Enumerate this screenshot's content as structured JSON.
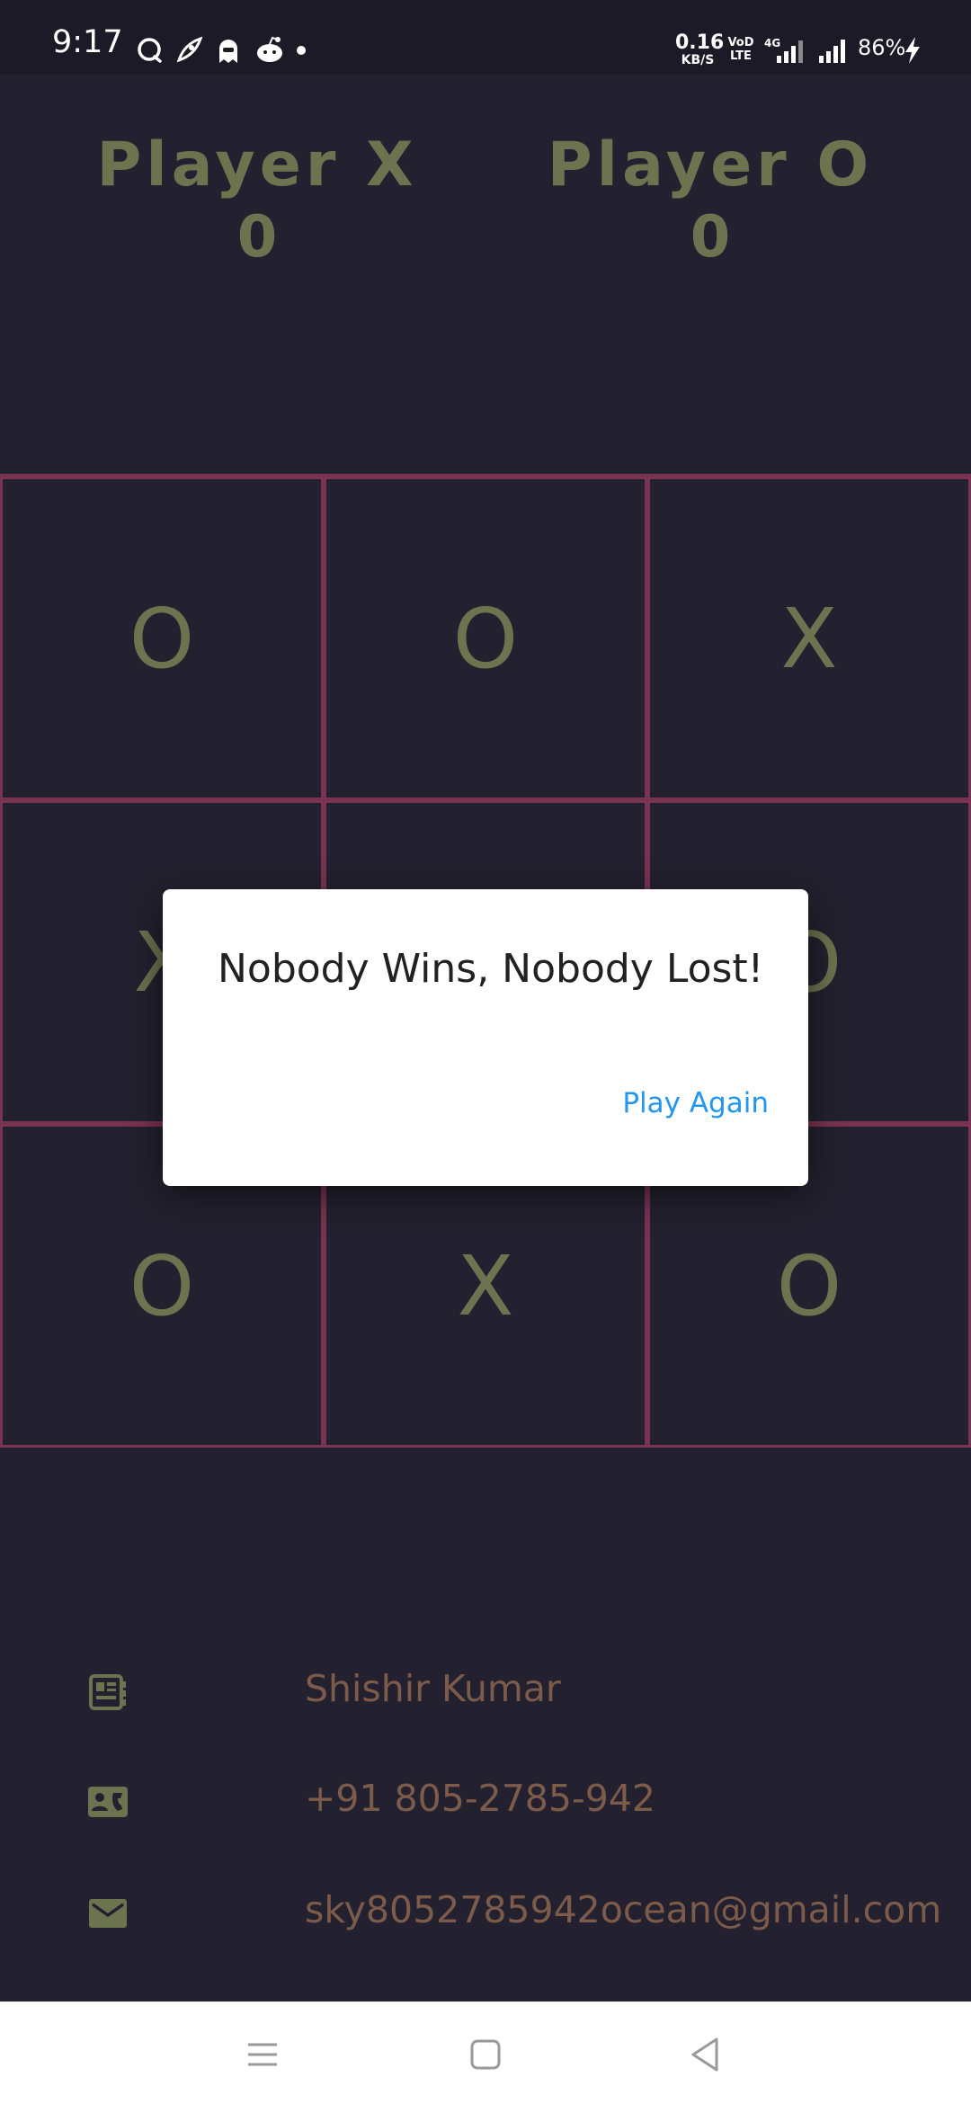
{
  "status_bar": {
    "time": "9:17",
    "net_speed_value": "0.16",
    "net_speed_unit": "KB/S",
    "volte_line1": "VoD",
    "volte_line2": "LTE",
    "network_type": "4G",
    "battery_percent": "86%",
    "notification_icons": [
      "chat-bubble-icon",
      "rocket-app-icon",
      "ghost-app-icon",
      "reddit-icon",
      "dot-icon"
    ]
  },
  "scoreboard": {
    "player_x": {
      "name": "Player X",
      "score": "0"
    },
    "player_o": {
      "name": "Player O",
      "score": "0"
    }
  },
  "board": {
    "cells": [
      "O",
      "O",
      "X",
      "X",
      "",
      "O",
      "O",
      "X",
      "O"
    ]
  },
  "dialog": {
    "message": "Nobody Wins, Nobody Lost!",
    "action_label": "Play Again"
  },
  "contact": {
    "name": "Shishir Kumar",
    "phone": "+91 805-2785-942",
    "email": "sky8052785942ocean@gmail.com",
    "icons": [
      "contact-card-icon",
      "id-card-icon",
      "mail-icon"
    ]
  },
  "nav_bar": {
    "icons": [
      "menu-icon",
      "home-square-icon",
      "back-triangle-icon"
    ]
  },
  "colors": {
    "background": "#23212f",
    "status_bar": "#1b1a26",
    "grid_line": "#7a3350",
    "mark": "#6b734f",
    "contact_text": "#7c5b4a",
    "dialog_action": "#2196f3"
  }
}
